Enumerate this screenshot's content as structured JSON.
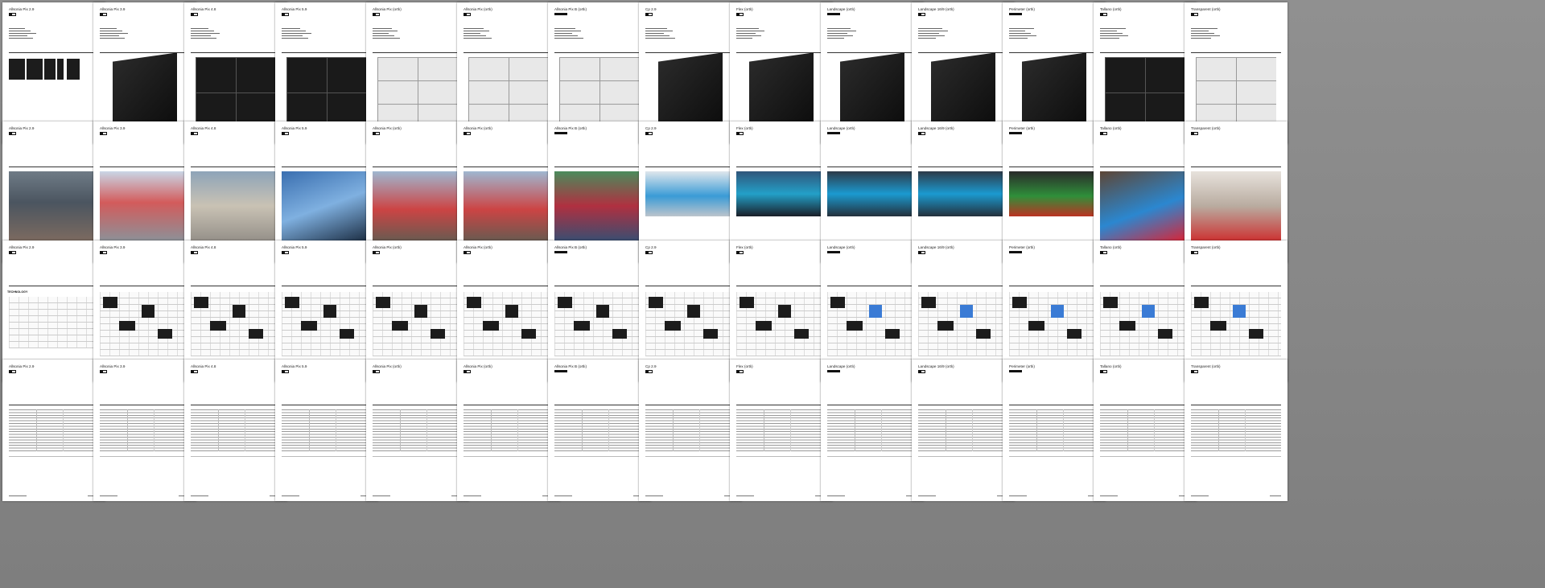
{
  "document": {
    "columns": [
      {
        "title": "Allsonia Pix 2.9",
        "logo": "box"
      },
      {
        "title": "Allsonia Pix 3.9",
        "logo": "box"
      },
      {
        "title": "Allsonia Pix 4.8",
        "logo": "box"
      },
      {
        "title": "Allsonia Pix 5.9",
        "logo": "box"
      },
      {
        "title": "Allsonia Pix (ortlı)",
        "logo": "box"
      },
      {
        "title": "Allsonia Pix (ortlı)",
        "logo": "box"
      },
      {
        "title": "Allsonia Pix B (ortlı)",
        "logo": "bar"
      },
      {
        "title": "Cp 2.9",
        "logo": "box"
      },
      {
        "title": "Flex (ortlı)",
        "logo": "box"
      },
      {
        "title": "Landscape (ortlı)",
        "logo": "bar"
      },
      {
        "title": "Landscape 16/9 (ortlı)",
        "logo": "box"
      },
      {
        "title": "Perimeter (ortlı)",
        "logo": "bar"
      },
      {
        "title": "Tallano (ortlı)",
        "logo": "box"
      },
      {
        "title": "Transparent (ortlı)",
        "logo": "box"
      }
    ],
    "technology_label": "TECHNOLOGY"
  }
}
